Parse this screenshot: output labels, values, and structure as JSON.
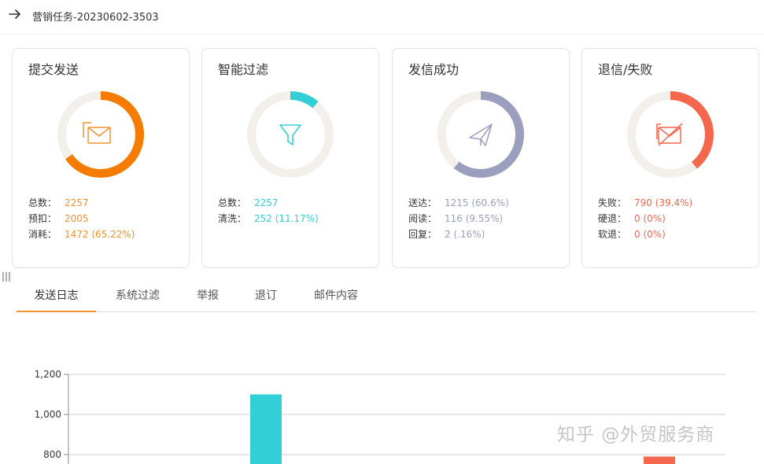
{
  "header": {
    "title": "营销任务-20230602-3503"
  },
  "cards": [
    {
      "title": "提交发送",
      "icon": "envelope-icon",
      "color": "#f57c00",
      "fraction": 0.6522,
      "stats": [
        {
          "label": "总数：",
          "value": "2257"
        },
        {
          "label": "预扣：",
          "value": "2005"
        },
        {
          "label": "消耗：",
          "value": "1472 (65.22%)"
        }
      ]
    },
    {
      "title": "智能过滤",
      "icon": "funnel-icon",
      "color": "#33cfd6",
      "fraction": 0.1117,
      "stats": [
        {
          "label": "总数：",
          "value": "2257"
        },
        {
          "label": "清洗：",
          "value": "252 (11.17%)"
        }
      ]
    },
    {
      "title": "发信成功",
      "icon": "paper-plane-icon",
      "color": "#9a9fbe",
      "fraction": 0.606,
      "stats": [
        {
          "label": "送达：",
          "value": "1215 (60.6%)"
        },
        {
          "label": "阅读：",
          "value": "116 (9.55%)"
        },
        {
          "label": "回复：",
          "value": "2 (.16%)"
        }
      ]
    },
    {
      "title": "退信/失败",
      "icon": "failed-mail-icon",
      "color": "#f4674c",
      "fraction": 0.394,
      "stats": [
        {
          "label": "失败：",
          "value": "790 (39.4%)"
        },
        {
          "label": "硬退：",
          "value": "0 (0%)"
        },
        {
          "label": "软退：",
          "value": "0 (0%)"
        }
      ]
    }
  ],
  "tabs": [
    {
      "label": "发送日志",
      "active": true
    },
    {
      "label": "系统过滤",
      "active": false
    },
    {
      "label": "举报",
      "active": false
    },
    {
      "label": "退订",
      "active": false
    },
    {
      "label": "邮件内容",
      "active": false
    }
  ],
  "chart_data": {
    "type": "bar",
    "y_ticks": [
      "1,200",
      "1,000",
      "800"
    ],
    "ylim": [
      800,
      1200
    ],
    "bars": [
      {
        "value": 1100,
        "color": "#33cfd6"
      },
      {
        "value": 790,
        "color": "#f4674c"
      }
    ],
    "grid": true
  },
  "watermark": "知乎 @外贸服务商"
}
